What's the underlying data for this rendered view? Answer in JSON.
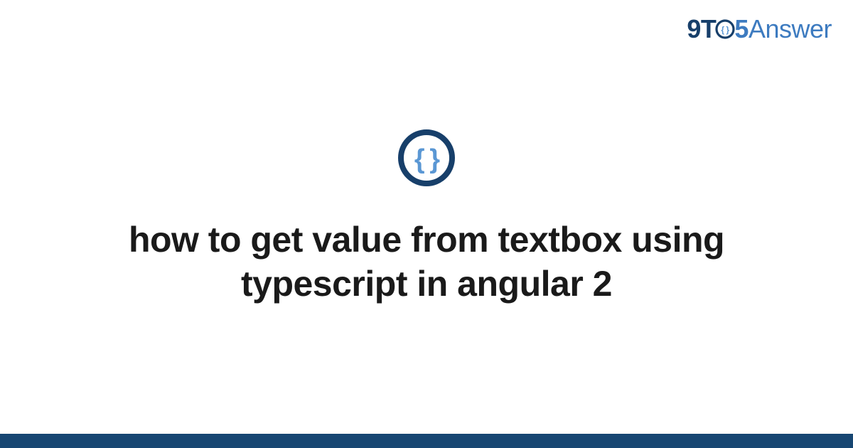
{
  "brand": {
    "part_nine": "9",
    "part_t": "T",
    "part_five": "5",
    "part_answer": "Answer"
  },
  "icon": {
    "name": "code-braces-icon",
    "ring_color": "#173f6a",
    "brace_color": "#5a97d4"
  },
  "heading": "how to get value from textbox using typescript in angular 2",
  "colors": {
    "bottom_bar": "#174672"
  }
}
